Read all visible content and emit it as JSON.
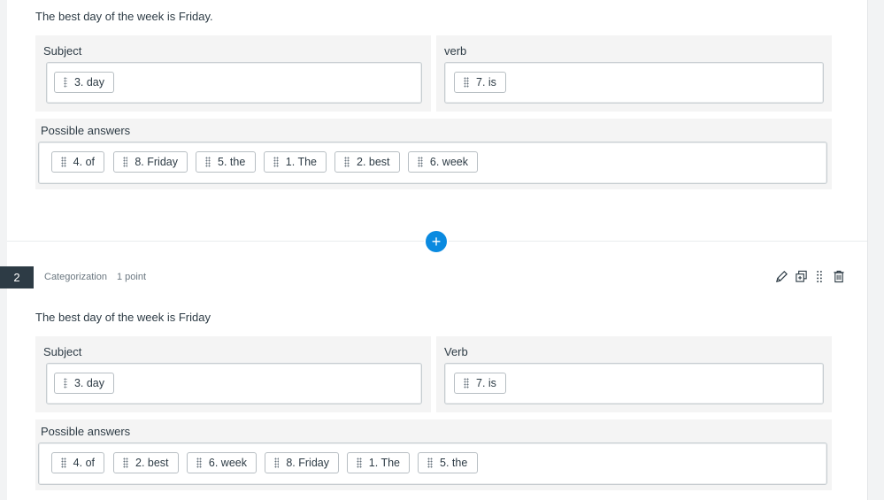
{
  "question1": {
    "prompt": "The best day of the week is Friday.",
    "categories": [
      {
        "label": "Subject",
        "items": [
          "3. day"
        ]
      },
      {
        "label": "verb",
        "items": [
          "7. is"
        ]
      }
    ],
    "possible_answers_label": "Possible answers",
    "possible_answers": [
      "4. of",
      "8. Friday",
      "5. the",
      "1. The",
      "2. best",
      "6. week"
    ]
  },
  "add_button_icon": "plus-icon",
  "question2": {
    "number": "2",
    "type": "Categorization",
    "points": "1 point",
    "prompt": "The best day of the week is Friday",
    "categories": [
      {
        "label": "Subject",
        "items": [
          "3. day"
        ]
      },
      {
        "label": "Verb",
        "items": [
          "7. is"
        ]
      }
    ],
    "possible_answers_label": "Possible answers",
    "possible_answers": [
      "4. of",
      "2. best",
      "6. week",
      "8. Friday",
      "1. The",
      "5. the"
    ],
    "toolbar_icons": [
      "pencil-icon",
      "copy-icon",
      "drag-handle-icon",
      "trash-icon"
    ]
  },
  "colors": {
    "accent": "#0a8ae0",
    "badge": "#2d3b45",
    "panel": "#f4f4f4",
    "text": "#2d3b45"
  }
}
